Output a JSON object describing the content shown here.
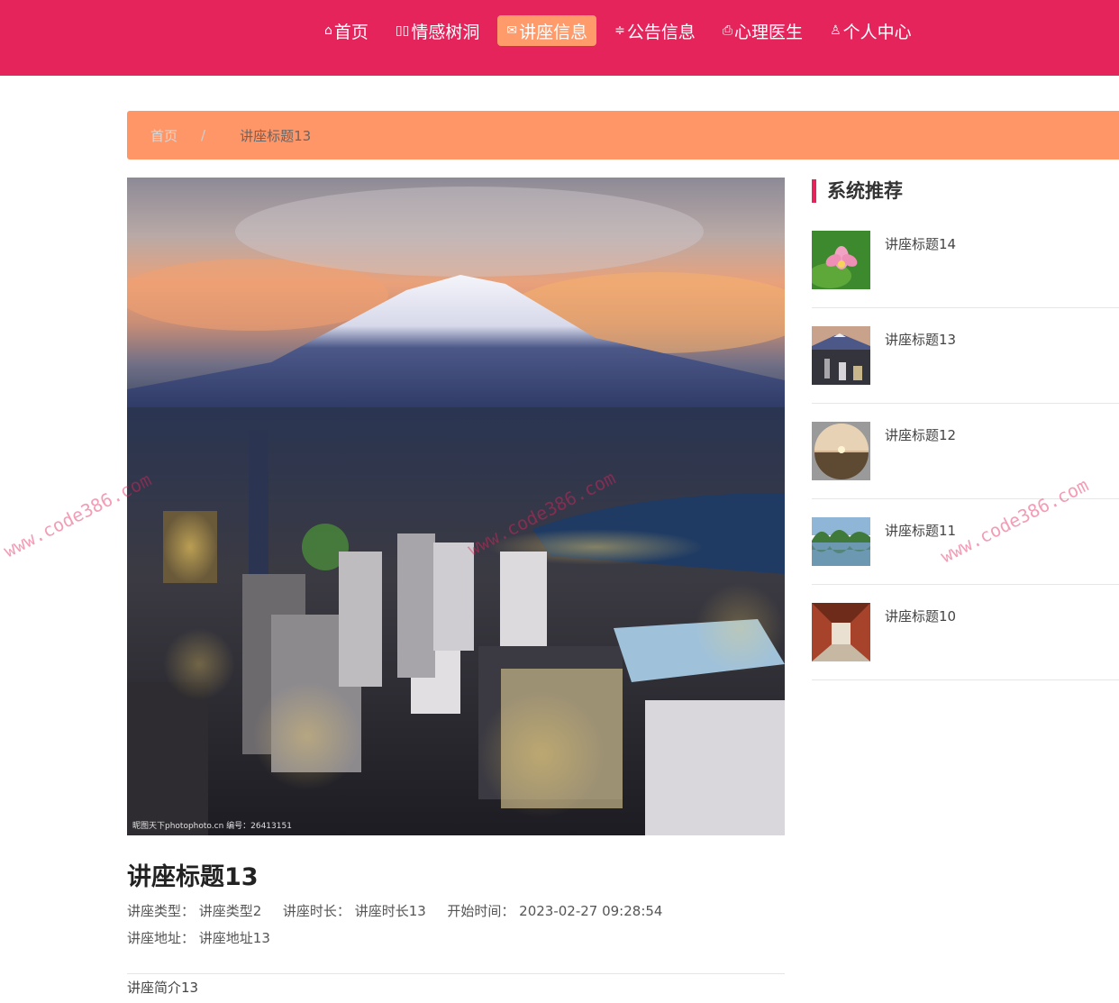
{
  "nav": [
    {
      "icon": "⌂",
      "label": "首页",
      "active": false
    },
    {
      "icon": "▯▯",
      "label": "情感树洞",
      "active": false
    },
    {
      "icon": "✉",
      "label": "讲座信息",
      "active": true
    },
    {
      "icon": "≑",
      "label": "公告信息",
      "active": false
    },
    {
      "icon": "⎙",
      "label": "心理医生",
      "active": false
    },
    {
      "icon": "♙",
      "label": "个人中心",
      "active": false
    }
  ],
  "breadcrumb": {
    "home": "首页",
    "separator": "/",
    "current": "讲座标题13"
  },
  "detail": {
    "image_credit": "昵图天下photophoto.cn 编号：26413151",
    "title": "讲座标题13",
    "type_label": "讲座类型：",
    "type_value": "讲座类型2",
    "duration_label": "讲座时长：",
    "duration_value": "讲座时长13",
    "start_label": "开始时间：",
    "start_value": "2023-02-27 09:28:54",
    "address_label": "讲座地址：",
    "address_value": "讲座地址13",
    "intro": "讲座简介13"
  },
  "sidebar": {
    "heading": "系统推荐",
    "items": [
      {
        "title": "讲座标题14",
        "thumb": "lotus-thumb"
      },
      {
        "title": "讲座标题13",
        "thumb": "city-mountain-thumb"
      },
      {
        "title": "讲座标题12",
        "thumb": "sunset-sphere-thumb"
      },
      {
        "title": "讲座标题11",
        "thumb": "lake-landscape-thumb"
      },
      {
        "title": "讲座标题10",
        "thumb": "corridor-thumb"
      }
    ]
  },
  "watermark": "www.code386.com",
  "colors": {
    "brand": "#e5245c",
    "accent": "#ff9668"
  }
}
